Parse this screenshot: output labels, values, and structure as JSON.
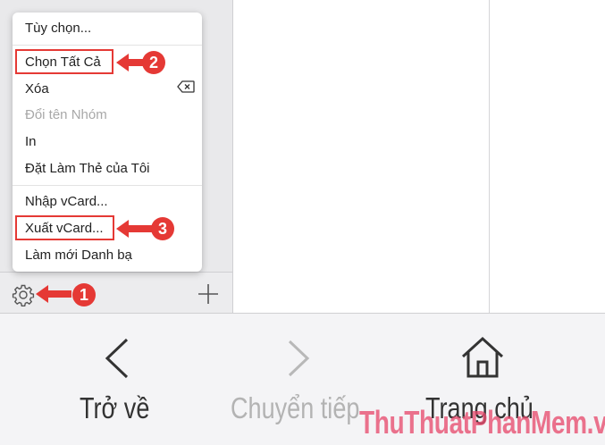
{
  "menu": {
    "items": [
      {
        "label": "Tùy chọn..."
      },
      {
        "label": "Chọn Tất Cả"
      },
      {
        "label": "Xóa"
      },
      {
        "label": "Đổi tên Nhóm"
      },
      {
        "label": "In"
      },
      {
        "label": "Đặt Làm Thẻ của Tôi"
      },
      {
        "label": "Nhập vCard..."
      },
      {
        "label": "Xuất vCard..."
      },
      {
        "label": "Làm mới Danh bạ"
      }
    ],
    "delete_key_icon": "backspace-key-icon"
  },
  "callouts": {
    "one": "1",
    "two": "2",
    "three": "3",
    "color": "#e53935"
  },
  "toolbar": {
    "back_label": "Trở về",
    "forward_label": "Chuyển tiếp",
    "home_label": "Trang chủ"
  },
  "watermark": {
    "part1": "ThuThuat",
    "part2": "PhanMem",
    "part3": ".vn"
  },
  "sidebar": {
    "settings_icon": "gear-icon",
    "add_icon": "plus-icon"
  }
}
